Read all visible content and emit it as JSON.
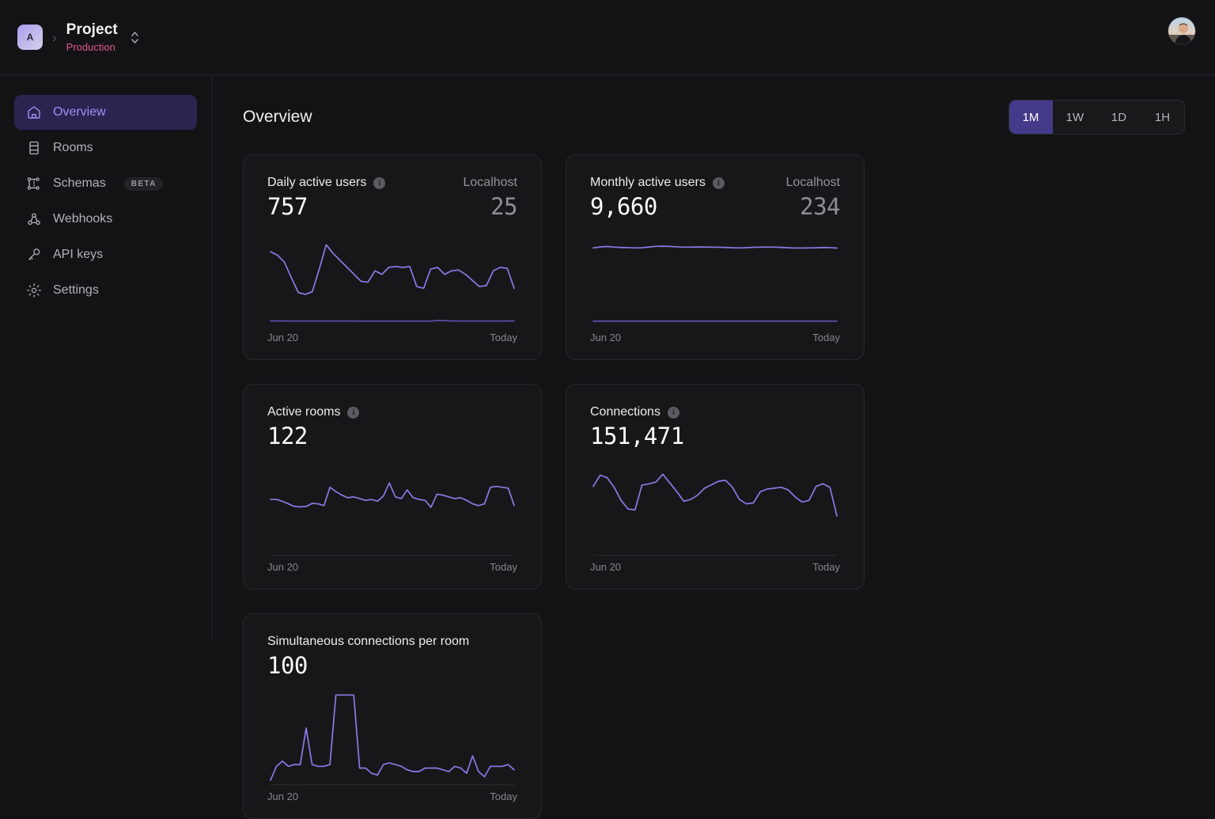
{
  "topbar": {
    "org_initial": "A",
    "breadcrumb_separator": "›",
    "project_name": "Project",
    "environment": "Production",
    "switcher_icon": "chevron-up-down-icon",
    "avatar_icon": "user-avatar"
  },
  "sidebar": {
    "items": [
      {
        "label": "Overview",
        "icon": "home-icon",
        "active": true,
        "badge": null
      },
      {
        "label": "Rooms",
        "icon": "rooms-icon",
        "active": false,
        "badge": null
      },
      {
        "label": "Schemas",
        "icon": "schemas-icon",
        "active": false,
        "badge": "BETA"
      },
      {
        "label": "Webhooks",
        "icon": "webhooks-icon",
        "active": false,
        "badge": null
      },
      {
        "label": "API keys",
        "icon": "key-icon",
        "active": false,
        "badge": null
      },
      {
        "label": "Settings",
        "icon": "gear-icon",
        "active": false,
        "badge": null
      }
    ]
  },
  "main": {
    "page_title": "Overview",
    "time_ranges": [
      {
        "label": "1M",
        "active": true
      },
      {
        "label": "1W",
        "active": false
      },
      {
        "label": "1D",
        "active": false
      },
      {
        "label": "1H",
        "active": false
      }
    ]
  },
  "colors": {
    "accent": "#8b7ae8",
    "accent_secondary": "#5b4fb0",
    "active_nav_bg": "#2a2450",
    "active_range_bg": "#443a8a",
    "page_bg": "#131316",
    "card_bg": "#171719",
    "env_pink": "#e0568a"
  },
  "cards": [
    {
      "title": "Daily active users",
      "has_info_icon": true,
      "value": "757",
      "sub_label": "Localhost",
      "sub_value": "25",
      "start_label": "Jun 20",
      "end_label": "Today",
      "has_baseline_divider": false
    },
    {
      "title": "Monthly active users",
      "has_info_icon": true,
      "value": "9,660",
      "sub_label": "Localhost",
      "sub_value": "234",
      "start_label": "Jun 20",
      "end_label": "Today",
      "has_baseline_divider": false
    },
    {
      "title": "Active rooms",
      "has_info_icon": true,
      "value": "122",
      "sub_label": null,
      "sub_value": null,
      "start_label": "Jun 20",
      "end_label": "Today",
      "has_baseline_divider": true
    },
    {
      "title": "Connections",
      "has_info_icon": true,
      "value": "151,471",
      "sub_label": null,
      "sub_value": null,
      "start_label": "Jun 20",
      "end_label": "Today",
      "has_baseline_divider": true
    },
    {
      "title": "Simultaneous connections per room",
      "has_info_icon": false,
      "value": "100",
      "sub_label": null,
      "sub_value": null,
      "start_label": "Jun 20",
      "end_label": "Today",
      "has_baseline_divider": true
    }
  ],
  "chart_data": [
    {
      "type": "line",
      "title": "Daily active users",
      "xlabel": "",
      "ylabel": "",
      "x": [
        "Jun 20",
        "Today"
      ],
      "grid": false,
      "legend": null,
      "ylim": [
        0,
        1000
      ],
      "series": [
        {
          "name": "Daily active users",
          "color": "#8b7ae8",
          "values": [
            820,
            780,
            700,
            520,
            350,
            330,
            360,
            620,
            900,
            800,
            720,
            640,
            560,
            480,
            470,
            600,
            560,
            640,
            650,
            640,
            650,
            420,
            400,
            620,
            640,
            560,
            600,
            610,
            560,
            490,
            420,
            430,
            600,
            640,
            630,
            400
          ]
        },
        {
          "name": "Localhost",
          "color": "#5b4fb0",
          "values": [
            25,
            24,
            24,
            23,
            23,
            23,
            23,
            23,
            23,
            23,
            23,
            23,
            23,
            22,
            22,
            22,
            22,
            22,
            22,
            22,
            22,
            22,
            22,
            22,
            30,
            27,
            24,
            23,
            23,
            23,
            23,
            23,
            23,
            23,
            23,
            25
          ]
        }
      ]
    },
    {
      "type": "line",
      "title": "Monthly active users",
      "xlabel": "",
      "ylabel": "",
      "x": [
        "Jun 20",
        "Today"
      ],
      "grid": false,
      "legend": null,
      "ylim": [
        0,
        11000
      ],
      "series": [
        {
          "name": "Monthly active users",
          "color": "#8b7ae8",
          "values": [
            9500,
            9620,
            9680,
            9600,
            9560,
            9540,
            9500,
            9520,
            9620,
            9700,
            9720,
            9690,
            9640,
            9600,
            9600,
            9620,
            9610,
            9600,
            9590,
            9560,
            9520,
            9500,
            9530,
            9580,
            9600,
            9610,
            9600,
            9570,
            9520,
            9490,
            9490,
            9500,
            9520,
            9560,
            9540,
            9480
          ]
        },
        {
          "name": "Localhost",
          "color": "#5b4fb0",
          "values": [
            234,
            234,
            234,
            234,
            234,
            234,
            234,
            234,
            234,
            234,
            234,
            234,
            234,
            234,
            234,
            234,
            234,
            234,
            234,
            234,
            234,
            234,
            234,
            234,
            234,
            234,
            234,
            234,
            234,
            234,
            234,
            234,
            234,
            234,
            234,
            234
          ]
        }
      ]
    },
    {
      "type": "line",
      "title": "Active rooms",
      "xlabel": "",
      "ylabel": "",
      "x": [
        "Jun 20",
        "Today"
      ],
      "grid": false,
      "legend": null,
      "ylim": [
        0,
        200
      ],
      "series": [
        {
          "name": "Active rooms",
          "color": "#8b7ae8",
          "values": [
            122,
            122,
            118,
            112,
            106,
            105,
            106,
            113,
            112,
            108,
            150,
            140,
            132,
            126,
            128,
            124,
            120,
            122,
            118,
            130,
            160,
            128,
            124,
            144,
            126,
            122,
            120,
            104,
            134,
            132,
            128,
            124,
            126,
            120,
            112,
            108,
            112,
            150,
            152,
            150,
            148,
            108
          ]
        }
      ]
    },
    {
      "type": "line",
      "title": "Connections",
      "xlabel": "",
      "ylabel": "",
      "x": [
        "Jun 20",
        "Today"
      ],
      "grid": false,
      "legend": null,
      "ylim": [
        0,
        200000
      ],
      "series": [
        {
          "name": "Connections",
          "color": "#8b7ae8",
          "values": [
            152000,
            178000,
            172000,
            150000,
            120000,
            100000,
            98000,
            155000,
            158000,
            162000,
            180000,
            160000,
            140000,
            118000,
            122000,
            132000,
            148000,
            156000,
            164000,
            166000,
            150000,
            122000,
            112000,
            114000,
            140000,
            146000,
            148000,
            150000,
            144000,
            128000,
            116000,
            120000,
            152000,
            158000,
            150000,
            84000
          ]
        }
      ]
    },
    {
      "type": "line",
      "title": "Simultaneous connections per room",
      "xlabel": "",
      "ylabel": "",
      "x": [
        "Jun 20",
        "Today"
      ],
      "grid": false,
      "legend": null,
      "ylim": [
        0,
        100
      ],
      "series": [
        {
          "name": "Simultaneous connections per room",
          "color": "#8b7ae8",
          "values": [
            2,
            18,
            24,
            18,
            20,
            20,
            62,
            20,
            18,
            18,
            20,
            100,
            100,
            100,
            100,
            16,
            16,
            10,
            8,
            20,
            22,
            20,
            18,
            14,
            12,
            12,
            16,
            16,
            16,
            14,
            12,
            18,
            16,
            10,
            30,
            12,
            6,
            18,
            18,
            18,
            20,
            14
          ]
        }
      ]
    }
  ]
}
